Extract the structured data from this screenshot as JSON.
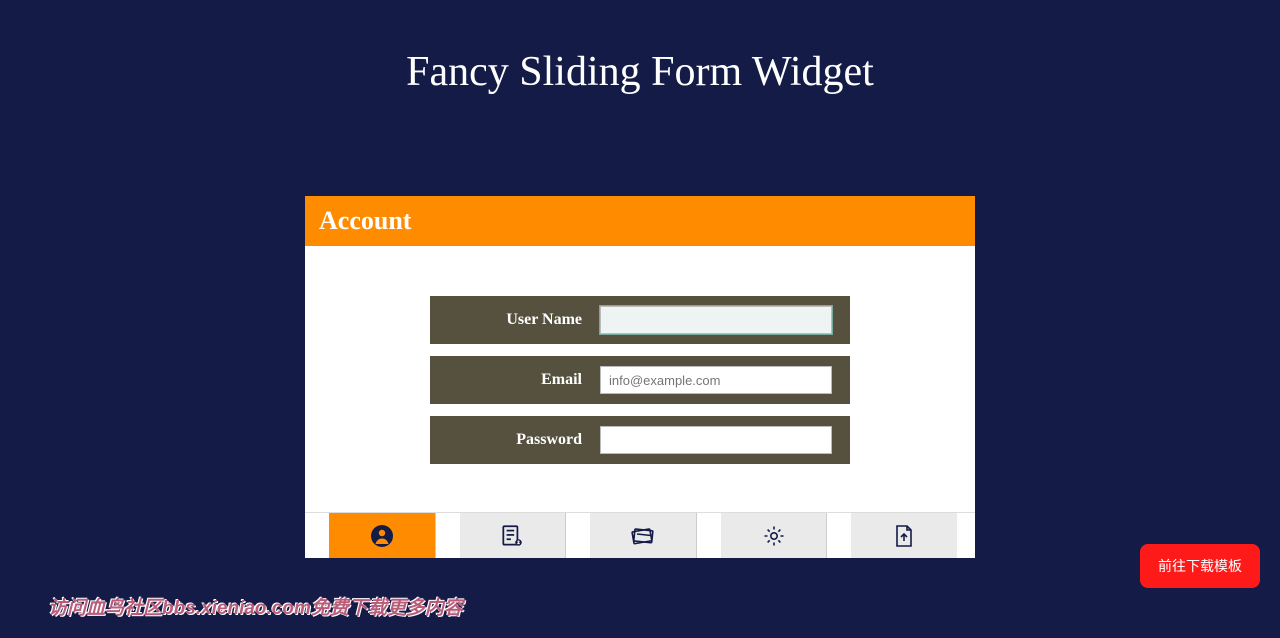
{
  "page": {
    "title": "Fancy Sliding Form Widget"
  },
  "widget": {
    "header": "Account",
    "fields": {
      "username": {
        "label": "User Name",
        "value": "",
        "placeholder": ""
      },
      "email": {
        "label": "Email",
        "value": "",
        "placeholder": "info@example.com"
      },
      "password": {
        "label": "Password",
        "value": "",
        "placeholder": ""
      }
    },
    "tabs": [
      {
        "icon": "user-icon",
        "active": true
      },
      {
        "icon": "document-icon",
        "active": false
      },
      {
        "icon": "card-icon",
        "active": false
      },
      {
        "icon": "gear-icon",
        "active": false
      },
      {
        "icon": "upload-icon",
        "active": false
      }
    ]
  },
  "download_button": "前往下载模板",
  "watermark": "访问血鸟社区bbs.xieniao.com免费下载更多内容"
}
